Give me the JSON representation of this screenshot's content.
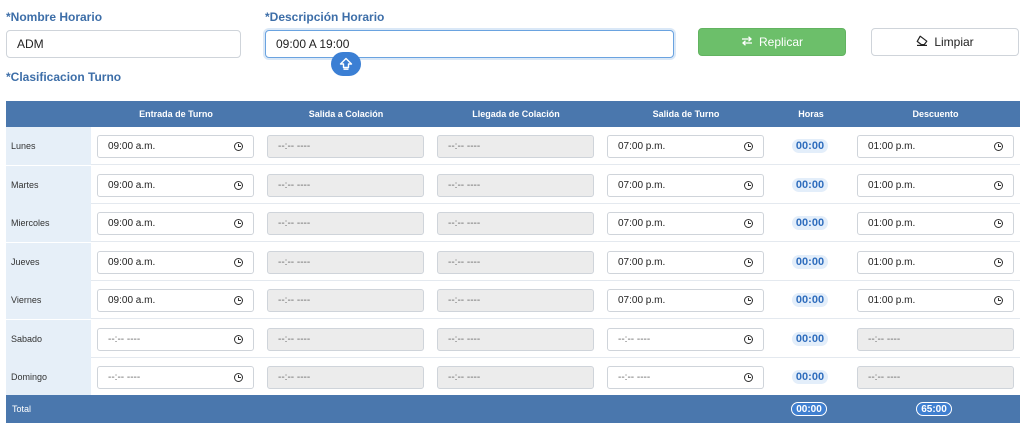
{
  "form": {
    "nombre_label": "*Nombre Horario",
    "nombre_value": "ADM",
    "descripcion_label": "*Descripción Horario",
    "descripcion_value": "09:00 A 19:00",
    "clasificacion_label": "*Clasificacion Turno",
    "replicar_label": "Replicar",
    "limpiar_label": "Limpiar"
  },
  "table": {
    "headers": [
      "Entrada de Turno",
      "Salida a Colación",
      "Llegada de Colación",
      "Salida de Turno",
      "Horas",
      "Descuento"
    ],
    "rows": [
      {
        "day": "Lunes",
        "entrada": "09:00 a.m.",
        "salida_colacion": "--:-- ----",
        "llegada_colacion": "--:-- ----",
        "salida_turno": "07:00 p.m.",
        "horas": "00:00",
        "descuento": "01:00 p.m."
      },
      {
        "day": "Martes",
        "entrada": "09:00 a.m.",
        "salida_colacion": "--:-- ----",
        "llegada_colacion": "--:-- ----",
        "salida_turno": "07:00 p.m.",
        "horas": "00:00",
        "descuento": "01:00 p.m."
      },
      {
        "day": "Miercoles",
        "entrada": "09:00 a.m.",
        "salida_colacion": "--:-- ----",
        "llegada_colacion": "--:-- ----",
        "salida_turno": "07:00 p.m.",
        "horas": "00:00",
        "descuento": "01:00 p.m."
      },
      {
        "day": "Jueves",
        "entrada": "09:00 a.m.",
        "salida_colacion": "--:-- ----",
        "llegada_colacion": "--:-- ----",
        "salida_turno": "07:00 p.m.",
        "horas": "00:00",
        "descuento": "01:00 p.m."
      },
      {
        "day": "Viernes",
        "entrada": "09:00 a.m.",
        "salida_colacion": "--:-- ----",
        "llegada_colacion": "--:-- ----",
        "salida_turno": "07:00 p.m.",
        "horas": "00:00",
        "descuento": "01:00 p.m."
      },
      {
        "day": "Sabado",
        "entrada": "--:-- ----",
        "salida_colacion": "--:-- ----",
        "llegada_colacion": "--:-- ----",
        "salida_turno": "--:-- ----",
        "horas": "00:00",
        "descuento": "--:-- ----"
      },
      {
        "day": "Domingo",
        "entrada": "--:-- ----",
        "salida_colacion": "--:-- ----",
        "llegada_colacion": "--:-- ----",
        "salida_turno": "--:-- ----",
        "horas": "00:00",
        "descuento": "--:-- ----"
      }
    ],
    "footer": {
      "label": "Total",
      "horas": "00:00",
      "descuento": "65:00"
    }
  },
  "icons": {
    "replicar": "swap-arrows-icon",
    "limpiar": "eraser-icon",
    "time": "clock-icon",
    "keyboard": "shift-arrow-icon"
  },
  "colors": {
    "accent": "#3d6ea8",
    "header_bg": "#4a77ad",
    "button_green": "#6cbf6a",
    "badge_blue": "#2f6dbd"
  }
}
